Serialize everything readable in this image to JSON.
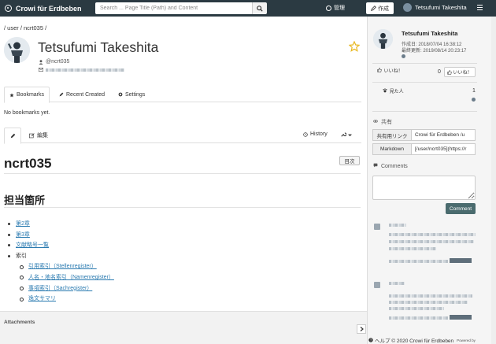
{
  "navbar": {
    "brand": "Crowi für Erdbeben",
    "search_placeholder": "Search ... Page Title (Path) and Content",
    "admin_label": "管理",
    "create_label": "作成",
    "user_name": "Tetsufumi Takeshita"
  },
  "breadcrumb": "/ user / ncrt035 /",
  "page": {
    "title": "Tetsufumi Takeshita",
    "handle": "@ncrt035"
  },
  "tabs": [
    {
      "label": "Bookmarks",
      "icon": "star-icon",
      "active": true
    },
    {
      "label": "Recent Created",
      "icon": "pencil-icon",
      "active": false
    },
    {
      "label": "Settings",
      "icon": "gear-icon",
      "active": false
    }
  ],
  "no_bookmarks": "No bookmarks yet.",
  "editor_tabs": {
    "edit_label": "編集",
    "history_label": "History"
  },
  "wiki": {
    "title": "ncrt035",
    "toc_label": "目次",
    "section": "担当箇所",
    "items": [
      "第2章",
      "第3章",
      "文献略号一覧",
      "索引"
    ],
    "subitems": [
      "引用索引（Stellenregister）",
      "人名・地名索引（Namenregister）",
      "事項索引（Sachregister）",
      "逸文サマリ"
    ]
  },
  "attachments_label": "Attachments",
  "sidebar": {
    "name": "Tetsufumi Takeshita",
    "created": "作成日: 2018/07/04 16:38:12",
    "updated": "最終更新: 2019/08/14 20:23:17",
    "like_label": "いいね！",
    "like_count": "0",
    "like_button": "いいね！",
    "seen_label": "見た人",
    "seen_count": "1",
    "share_label": "共有",
    "share_link_key": "共有用リンク",
    "share_link_value": "Crowi für Erdbeben /u",
    "markdown_key": "Markdown",
    "markdown_value": "[/user/ncrt035](https://r",
    "comments_label": "Comments",
    "comment_button": "Comment"
  },
  "footer": {
    "text": "ヘルプ © 2020 Crowi für Erdbeben",
    "powered": "Powered by"
  },
  "colors": {
    "navbar": "#2b3a42",
    "accent_button": "#4a6b6e",
    "link": "#2a7ab0",
    "star": "#e8b820"
  }
}
